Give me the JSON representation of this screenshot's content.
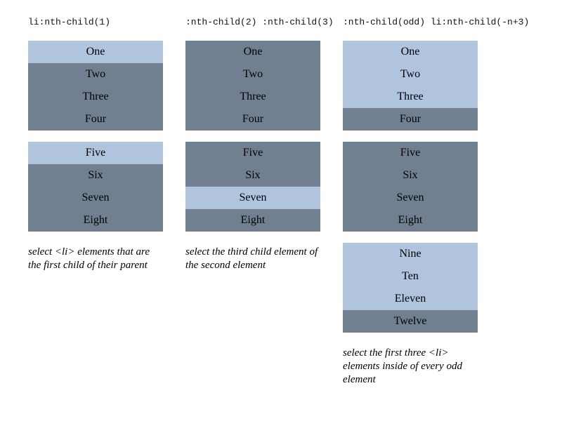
{
  "page": {
    "background_color": "#ffffff",
    "highlight_color": "#b0c4de",
    "base_color": "#708090",
    "text_color": "#000000"
  },
  "columns": [
    {
      "header": "li:nth-child(1)",
      "caption": "select <li> elements that are the first child of their parent",
      "lists": [
        {
          "items": [
            {
              "label": "One",
              "highlighted": true
            },
            {
              "label": "Two",
              "highlighted": false
            },
            {
              "label": "Three",
              "highlighted": false
            },
            {
              "label": "Four",
              "highlighted": false
            }
          ]
        },
        {
          "items": [
            {
              "label": "Five",
              "highlighted": true
            },
            {
              "label": "Six",
              "highlighted": false
            },
            {
              "label": "Seven",
              "highlighted": false
            },
            {
              "label": "Eight",
              "highlighted": false
            }
          ]
        }
      ]
    },
    {
      "header": ":nth-child(2) :nth-child(3)",
      "caption": "select the third child element of the second element",
      "lists": [
        {
          "items": [
            {
              "label": "One",
              "highlighted": false
            },
            {
              "label": "Two",
              "highlighted": false
            },
            {
              "label": "Three",
              "highlighted": false
            },
            {
              "label": "Four",
              "highlighted": false
            }
          ]
        },
        {
          "items": [
            {
              "label": "Five",
              "highlighted": false
            },
            {
              "label": "Six",
              "highlighted": false
            },
            {
              "label": "Seven",
              "highlighted": true
            },
            {
              "label": "Eight",
              "highlighted": false
            }
          ]
        }
      ]
    },
    {
      "header": ":nth-child(odd) li:nth-child(-n+3)",
      "caption": "select the first three <li> elements inside of every odd element",
      "lists": [
        {
          "items": [
            {
              "label": "One",
              "highlighted": true
            },
            {
              "label": "Two",
              "highlighted": true
            },
            {
              "label": "Three",
              "highlighted": true
            },
            {
              "label": "Four",
              "highlighted": false
            }
          ]
        },
        {
          "items": [
            {
              "label": "Five",
              "highlighted": false
            },
            {
              "label": "Six",
              "highlighted": false
            },
            {
              "label": "Seven",
              "highlighted": false
            },
            {
              "label": "Eight",
              "highlighted": false
            }
          ]
        },
        {
          "items": [
            {
              "label": "Nine",
              "highlighted": true
            },
            {
              "label": "Ten",
              "highlighted": true
            },
            {
              "label": "Eleven",
              "highlighted": true
            },
            {
              "label": "Twelve",
              "highlighted": false
            }
          ]
        }
      ]
    }
  ]
}
